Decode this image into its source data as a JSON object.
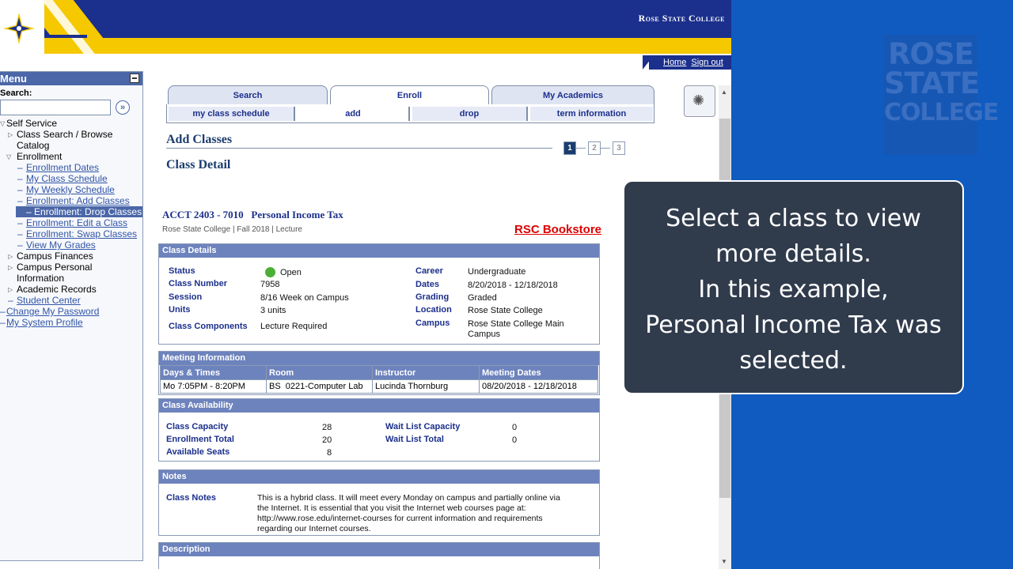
{
  "header": {
    "college_name": "Rose State College",
    "links": {
      "home": "Home",
      "signout": "Sign out"
    }
  },
  "menu": {
    "title": "Menu",
    "search_label": "Search:",
    "search_value": "",
    "search_go": "»",
    "items": [
      {
        "label": "Self Service",
        "level": 0
      },
      {
        "label": "Class Search / Browse Catalog",
        "level": 1
      },
      {
        "label": "Enrollment",
        "level": 1
      },
      {
        "label": "Enrollment Dates",
        "level": 2
      },
      {
        "label": "My Class Schedule",
        "level": 2
      },
      {
        "label": "My Weekly Schedule",
        "level": 2
      },
      {
        "label": "Enrollment: Add Classes",
        "level": 2
      },
      {
        "label": "Enrollment: Drop Classes",
        "level": 2,
        "selected": true
      },
      {
        "label": "Enrollment: Edit a Class",
        "level": 2
      },
      {
        "label": "Enrollment: Swap Classes",
        "level": 2
      },
      {
        "label": "View My Grades",
        "level": 2
      },
      {
        "label": "Campus Finances",
        "level": 1
      },
      {
        "label": "Campus Personal Information",
        "level": 1
      },
      {
        "label": "Academic Records",
        "level": 1
      },
      {
        "label": "Student Center",
        "level": 1
      },
      {
        "label": "Change My Password",
        "level": 0
      },
      {
        "label": "My System Profile",
        "level": 0
      }
    ]
  },
  "tabs": [
    "Search",
    "Enroll",
    "My Academics"
  ],
  "subtabs": [
    "my class schedule",
    "add",
    "drop",
    "term information"
  ],
  "page": {
    "title": "Add Classes",
    "subtitle": "Class Detail",
    "steps": [
      "1",
      "2",
      "3"
    ],
    "course_title": "ACCT 2403 - 7010   Personal Income Tax",
    "course_meta": "Rose State College | Fall 2018 | Lecture",
    "bookstore": "RSC Bookstore"
  },
  "class_details": {
    "heading": "Class Details",
    "status_label": "Status",
    "status_value": "Open",
    "number_label": "Class Number",
    "number_value": "7958",
    "session_label": "Session",
    "session_value": "8/16 Week on Campus",
    "units_label": "Units",
    "units_value": "3 units",
    "components_label": "Class Components",
    "components_value": "Lecture Required",
    "career_label": "Career",
    "career_value": "Undergraduate",
    "dates_label": "Dates",
    "dates_value": "8/20/2018 - 12/18/2018",
    "grading_label": "Grading",
    "grading_value": "Graded",
    "location_label": "Location",
    "location_value": "Rose State College",
    "campus_label": "Campus",
    "campus_value_1": "Rose State College Main",
    "campus_value_2": "Campus"
  },
  "meeting": {
    "heading": "Meeting Information",
    "columns": [
      "Days & Times",
      "Room",
      "Instructor",
      "Meeting Dates"
    ],
    "row": [
      "Mo 7:05PM - 8:20PM",
      "BS  0221-Computer Lab",
      "Lucinda Thornburg",
      "08/20/2018 - 12/18/2018"
    ]
  },
  "availability": {
    "heading": "Class Availability",
    "capacity_label": "Class Capacity",
    "capacity_value": "28",
    "enrolled_label": "Enrollment Total",
    "enrolled_value": "20",
    "seats_label": "Available Seats",
    "seats_value": "8",
    "wl_capacity_label": "Wait List Capacity",
    "wl_capacity_value": "0",
    "wl_total_label": "Wait List Total",
    "wl_total_value": "0"
  },
  "notes": {
    "heading": "Notes",
    "label": "Class Notes",
    "lines": [
      "This is a hybrid class. It will meet every Monday on campus and partially online via",
      "the Internet. It is essential that you visit the Internet web courses page at:",
      "http://www.rose.edu/internet-courses for current information and requirements",
      "regarding our Internet courses."
    ]
  },
  "description": {
    "heading": "Description"
  },
  "callout": {
    "lines": [
      "Select a class to view",
      "more details.",
      "In this example,",
      "Personal Income Tax was",
      "selected."
    ]
  },
  "watermark": {
    "lines": [
      "ROSE",
      "STATE",
      "COLLEGE"
    ]
  },
  "colors": {
    "navy": "#1b2f8c",
    "gold": "#f5c800",
    "section_header": "#6d83bd",
    "background_blue": "#0f5bc0",
    "bookstore_red": "#dd0000"
  }
}
